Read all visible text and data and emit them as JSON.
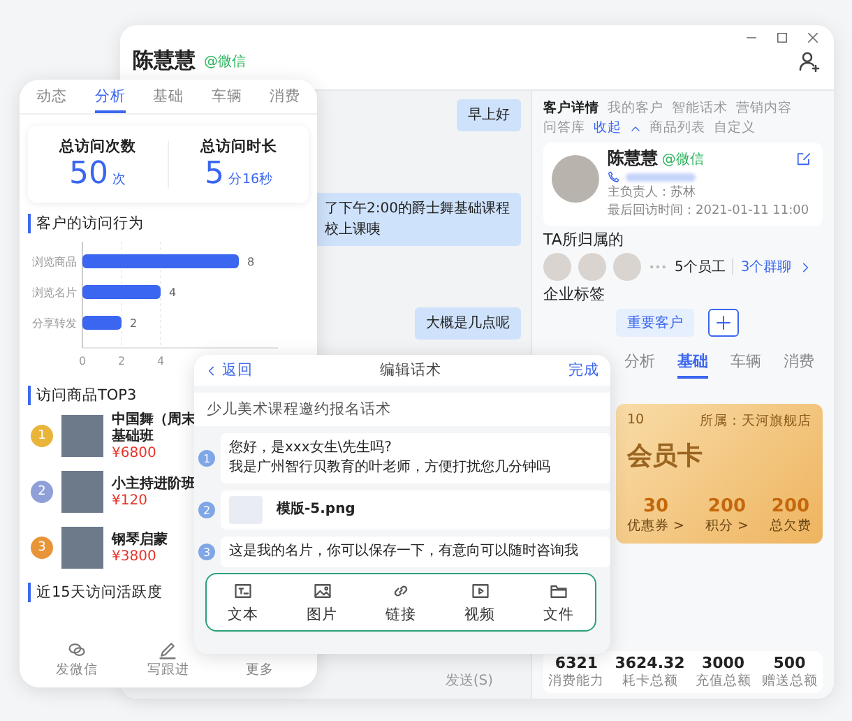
{
  "window": {
    "name": "陈慧慧",
    "channel": "@微信"
  },
  "chat": {
    "messages": [
      {
        "lines": [
          "早上好"
        ]
      },
      {
        "lines": [
          "了下午2:00的爵士舞基础课程",
          "校上课咦"
        ]
      },
      {
        "lines": [
          "大概是几点呢"
        ]
      }
    ],
    "send": "发送(S)"
  },
  "customer_panel": {
    "tabs": [
      {
        "label": "客户详情",
        "selected": true
      },
      {
        "label": "我的客户",
        "selected": false
      },
      {
        "label": "智能话术",
        "selected": false
      },
      {
        "label": "营销内容",
        "selected": false
      },
      {
        "label": "问答库",
        "selected": false
      },
      {
        "label": "商品列表",
        "selected": false
      },
      {
        "label": "自定义",
        "selected": false
      }
    ],
    "collapse": "收起",
    "profile": {
      "name": "陈慧慧",
      "channel": "@微信",
      "owner": "主负责人：苏林",
      "last_visit": "最后回访时间：2021-01-11 11:00"
    },
    "belongs_title": "TA所归属的",
    "staff": "5个员工",
    "groups": "3个群聊",
    "tags_title": "企业标签",
    "tags": [
      "重要客户"
    ],
    "detail_tabs": [
      {
        "label": "分析",
        "selected": false
      },
      {
        "label": "基础",
        "selected": true
      },
      {
        "label": "车辆",
        "selected": false
      },
      {
        "label": "消费",
        "selected": false
      }
    ],
    "member_card": {
      "fragment": "10",
      "store": "所属：天河旗舰店",
      "title": "会员卡",
      "stats": [
        {
          "value": "30",
          "label": "优惠券 >"
        },
        {
          "value": "200",
          "label": "积分 >"
        },
        {
          "value": "200",
          "label": "总欠费"
        }
      ]
    },
    "totals": [
      {
        "value": "6321",
        "label": "消费能力"
      },
      {
        "value": "3624.32",
        "label": "耗卡总额"
      },
      {
        "value": "3000",
        "label": "充值总额"
      },
      {
        "value": "500",
        "label": "赠送总额"
      }
    ]
  },
  "analysis_panel": {
    "tabs": [
      {
        "label": "动态",
        "selected": false
      },
      {
        "label": "分析",
        "selected": true
      },
      {
        "label": "基础",
        "selected": false
      },
      {
        "label": "车辆",
        "selected": false
      },
      {
        "label": "消费",
        "selected": false
      }
    ],
    "summary": [
      {
        "label": "总访问次数",
        "value": "50",
        "unit": "次"
      },
      {
        "label": "总访问时长",
        "value": "5",
        "unit": "分16秒"
      }
    ],
    "behavior_title": "客户的访问行为",
    "chart_data": {
      "type": "bar",
      "orientation": "horizontal",
      "categories": [
        "浏览商品",
        "浏览名片",
        "分享转发"
      ],
      "values": [
        8,
        4,
        2
      ],
      "xlim": [
        0,
        10
      ],
      "xticks": [
        0,
        2,
        4
      ],
      "data_labels": true
    },
    "top_title": "访问商品TOP3",
    "products": [
      {
        "rank": "1",
        "color": "#e9b43a",
        "name": "中国舞（周末基础班",
        "price": "¥6800"
      },
      {
        "rank": "2",
        "color": "#8f9fd8",
        "name": "小主持进阶班",
        "price": "¥120"
      },
      {
        "rank": "3",
        "color": "#e8953a",
        "name": "钢琴启蒙",
        "price": "¥3800"
      }
    ],
    "activity_title": "近15天访问活跃度",
    "nav": [
      {
        "kind": "chat",
        "label": "发微信"
      },
      {
        "kind": "edit",
        "label": "写跟进"
      },
      {
        "kind": "more",
        "label": "更多"
      }
    ]
  },
  "script_dialog": {
    "back": "返回",
    "title": "编辑话术",
    "done": "完成",
    "script_title": "少儿美术课程邀约报名话术",
    "steps": [
      {
        "number": "1",
        "kind": "text",
        "lines": [
          "您好，是xxx女生\\先生吗?",
          "我是广州智行贝教育的叶老师，方便打扰您几分钟吗"
        ]
      },
      {
        "number": "2",
        "kind": "file",
        "name": "模版-5.png"
      },
      {
        "number": "3",
        "kind": "text",
        "lines": [
          "这是我的名片，你可以保存一下，有意向可以随时咨询我"
        ]
      }
    ],
    "toolbar": [
      {
        "kind": "text",
        "label": "文本"
      },
      {
        "kind": "image",
        "label": "图片"
      },
      {
        "kind": "link",
        "label": "链接"
      },
      {
        "kind": "video",
        "label": "视频"
      },
      {
        "kind": "file",
        "label": "文件"
      }
    ]
  }
}
